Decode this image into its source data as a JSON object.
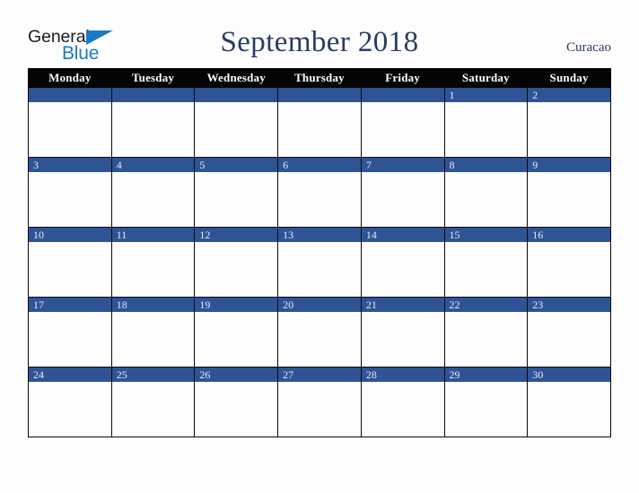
{
  "brand": {
    "name_part1": "General",
    "name_part2": "Blue",
    "triangle_icon": "triangle-icon",
    "accent_color": "#1a7ac4"
  },
  "header": {
    "title": "September 2018",
    "month": "September",
    "year": "2018",
    "locale": "Curacao",
    "title_color": "#2a3c63"
  },
  "calendar": {
    "accent_blue": "#2f5496",
    "header_bg": "#040404",
    "weekdays": [
      "Monday",
      "Tuesday",
      "Wednesday",
      "Thursday",
      "Friday",
      "Saturday",
      "Sunday"
    ],
    "weeks": [
      [
        "",
        "",
        "",
        "",
        "",
        "1",
        "2"
      ],
      [
        "3",
        "4",
        "5",
        "6",
        "7",
        "8",
        "9"
      ],
      [
        "10",
        "11",
        "12",
        "13",
        "14",
        "15",
        "16"
      ],
      [
        "17",
        "18",
        "19",
        "20",
        "21",
        "22",
        "23"
      ],
      [
        "24",
        "25",
        "26",
        "27",
        "28",
        "29",
        "30"
      ]
    ]
  }
}
